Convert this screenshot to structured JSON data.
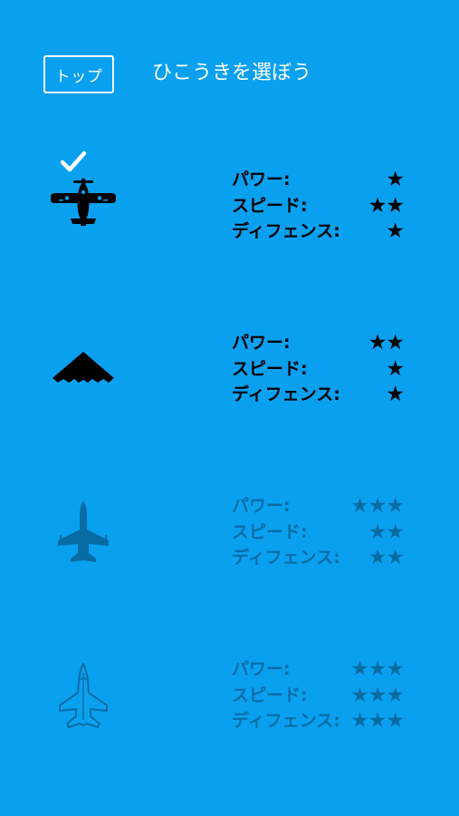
{
  "header": {
    "top_button_label": "トップ",
    "title": "ひこうきを選ぼう"
  },
  "colors": {
    "background": "#0aa0f0",
    "foreground": "#000000",
    "header_text": "#ffffff",
    "locked_opacity": "0.32"
  },
  "planes": [
    {
      "icon": "propeller-plane-icon",
      "selected": true,
      "locked": false,
      "stats": [
        {
          "label": "パワー:",
          "stars": "★"
        },
        {
          "label": "スピード:",
          "stars": "★★"
        },
        {
          "label": "ディフェンス:",
          "stars": "★"
        }
      ]
    },
    {
      "icon": "stealth-bomber-icon",
      "selected": false,
      "locked": false,
      "stats": [
        {
          "label": "パワー:",
          "stars": "★★"
        },
        {
          "label": "スピード:",
          "stars": "★"
        },
        {
          "label": "ディフェンス:",
          "stars": "★"
        }
      ]
    },
    {
      "icon": "fighter-jet-icon",
      "selected": false,
      "locked": true,
      "stats": [
        {
          "label": "パワー:",
          "stars": "★★★"
        },
        {
          "label": "スピード:",
          "stars": "★★"
        },
        {
          "label": "ディフェンス:",
          "stars": "★★"
        }
      ]
    },
    {
      "icon": "stealth-fighter-icon",
      "selected": false,
      "locked": true,
      "stats": [
        {
          "label": "パワー:",
          "stars": "★★★"
        },
        {
          "label": "スピード:",
          "stars": "★★★"
        },
        {
          "label": "ディフェンス:",
          "stars": "★★★"
        }
      ]
    }
  ]
}
